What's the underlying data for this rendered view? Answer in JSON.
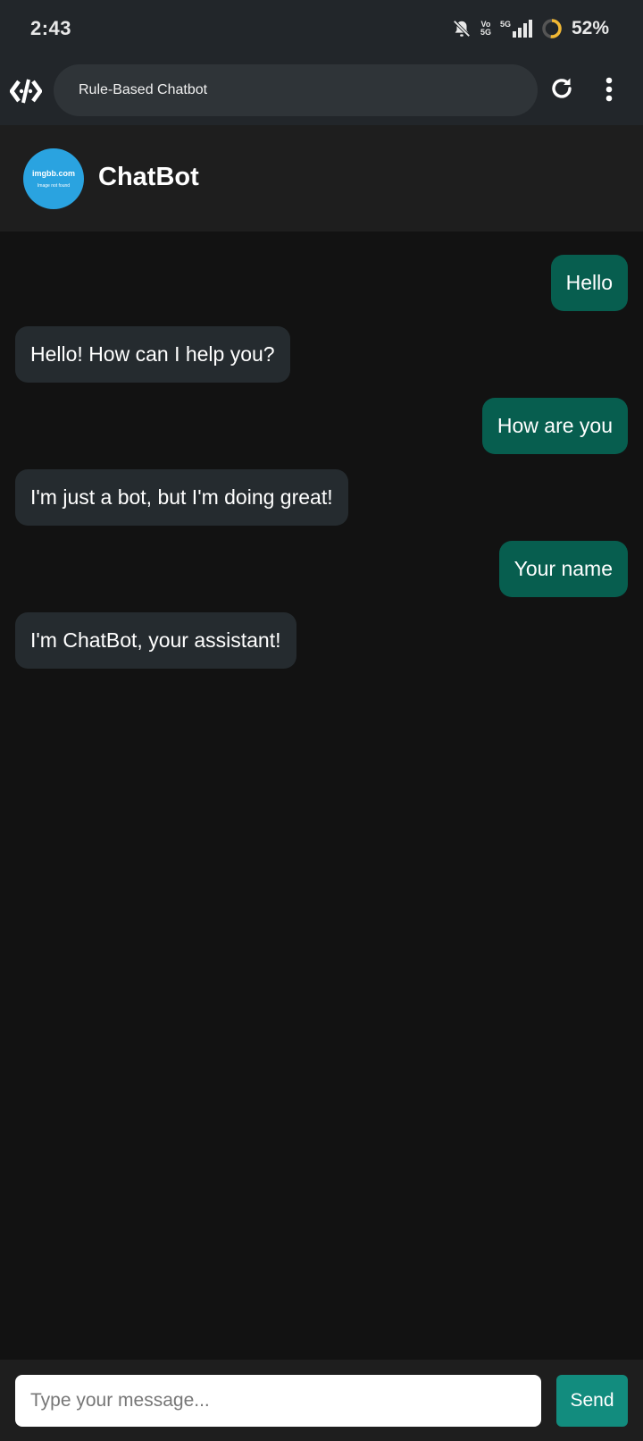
{
  "status_bar": {
    "time": "2:43",
    "volte_top": "Vo",
    "volte_bottom": "5G",
    "network": "5G",
    "battery": "52%"
  },
  "browser": {
    "title": "Rule-Based Chatbot",
    "icons": [
      "code-icon",
      "reload-icon",
      "more-vert-icon"
    ]
  },
  "chat_header": {
    "avatar_line1": "imgbb.com",
    "avatar_line2": "Image not found",
    "title": "ChatBot"
  },
  "messages": [
    {
      "sender": "user",
      "text": "Hello"
    },
    {
      "sender": "bot",
      "text": "Hello! How can I help you?"
    },
    {
      "sender": "user",
      "text": "How are you"
    },
    {
      "sender": "bot",
      "text": "I'm just a bot, but I'm doing great!"
    },
    {
      "sender": "user",
      "text": "Your name"
    },
    {
      "sender": "bot",
      "text": "I'm ChatBot, your assistant!"
    }
  ],
  "composer": {
    "placeholder": "Type your message...",
    "value": "",
    "send_label": "Send"
  },
  "colors": {
    "user_bubble": "#075e4f",
    "bot_bubble": "#252b2f",
    "send_button": "#128c7e",
    "avatar": "#2aa3e0"
  }
}
